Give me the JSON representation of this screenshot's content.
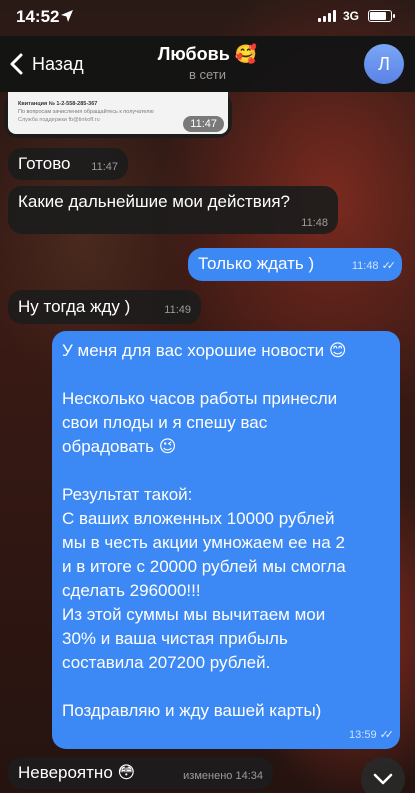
{
  "status_bar": {
    "time": "14:52",
    "network": "3G",
    "icons": [
      "location-arrow-icon",
      "signal-bars-icon",
      "battery-icon"
    ]
  },
  "header": {
    "back_label": "Назад",
    "contact_name": "Любовь 🥰",
    "contact_status": "в сети",
    "avatar_letter": "Л",
    "avatar_color": "#6a93ee"
  },
  "receipt": {
    "number_line": "Квитанция № 1-2-558-285-367",
    "note_line": "По вопросам зачисления обращайтесь к получателю",
    "support_line": "Служба поддержки fb@tinkoff.ru",
    "time": "11:47"
  },
  "messages": [
    {
      "id": "m1",
      "direction": "in",
      "text": "Готово",
      "time": "11:47"
    },
    {
      "id": "m2",
      "direction": "in",
      "text": "Какие дальнейшие мои действия?",
      "time": "11:48"
    },
    {
      "id": "m3",
      "direction": "out",
      "text": "Только ждать )",
      "time": "11:48",
      "read": true
    },
    {
      "id": "m4",
      "direction": "in",
      "text": "Ну тогда жду )",
      "time": "11:49"
    },
    {
      "id": "m5",
      "direction": "out",
      "lines": [
        "У меня для вас хорошие новости 😊",
        "",
        "Несколько часов работы принесли",
        "свои плоды и я спешу вас",
        "обрадовать 😉",
        "",
        "Результат такой:",
        "С ваших вложенных 10000 рублей",
        "мы в честь акции умножаем ее на 2",
        "и в итоге с 20000 рублей мы смогла",
        "сделать 296000!!!",
        "Из этой суммы мы вычитаем мои",
        "30% и ваша чистая прибыль",
        "составила 207200 рублей.",
        "",
        "Поздравляю и жду вашей карты)"
      ],
      "time": "13:59",
      "read": true
    },
    {
      "id": "m6",
      "direction": "in",
      "text": "Невероятно 😳",
      "time": "изменено 14:34"
    }
  ],
  "colors": {
    "outgoing_bubble": "#3c89f5",
    "incoming_bubble": "#1c1c1c",
    "header_bg": "#141414"
  }
}
